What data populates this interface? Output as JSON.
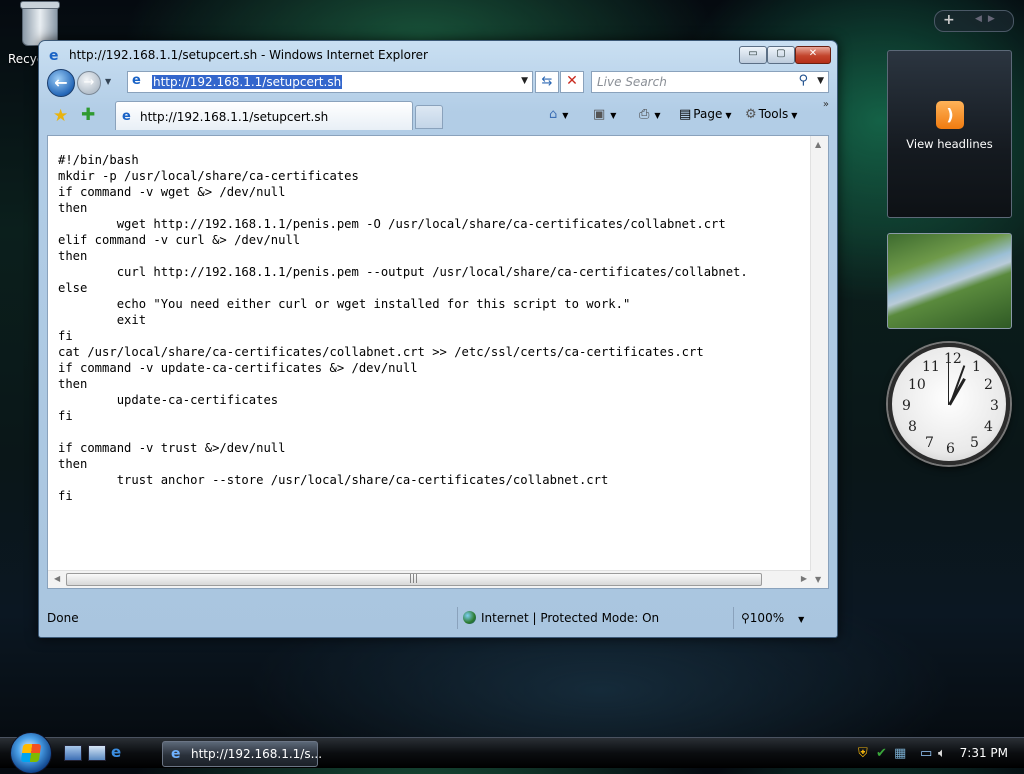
{
  "desktop": {
    "recycle_bin_label": "Recyc"
  },
  "window": {
    "title": "http://192.168.1.1/setupcert.sh - Windows Internet Explorer",
    "buttons": {
      "minimize": "▭",
      "maximize": "▢",
      "close": "✕"
    }
  },
  "nav": {
    "address": "http://192.168.1.1/setupcert.sh",
    "search_placeholder": "Live Search"
  },
  "tab": {
    "label": "http://192.168.1.1/setupcert.sh"
  },
  "command_bar": {
    "page_label": "Page",
    "tools_label": "Tools"
  },
  "content": {
    "code": "#!/bin/bash\nmkdir -p /usr/local/share/ca-certificates\nif command -v wget &> /dev/null\nthen\n        wget http://192.168.1.1/penis.pem -O /usr/local/share/ca-certificates/collabnet.crt\nelif command -v curl &> /dev/null\nthen\n        curl http://192.168.1.1/penis.pem --output /usr/local/share/ca-certificates/collabnet.\nelse\n        echo \"You need either curl or wget installed for this script to work.\"\n        exit\nfi\ncat /usr/local/share/ca-certificates/collabnet.crt >> /etc/ssl/certs/ca-certificates.crt\nif command -v update-ca-certificates &> /dev/null\nthen\n        update-ca-certificates\nfi\n\nif command -v trust &>/dev/null\nthen\n        trust anchor --store /usr/local/share/ca-certificates/collabnet.crt\nfi"
  },
  "status": {
    "text": "Done",
    "zone": "Internet | Protected Mode: On",
    "zoom": "100%"
  },
  "sidebar": {
    "feed_label": "View headlines",
    "clock_numbers": [
      "12",
      "1",
      "2",
      "3",
      "4",
      "5",
      "6",
      "7",
      "8",
      "9",
      "10",
      "11"
    ]
  },
  "taskbar": {
    "task_label": "http://192.168.1.1/s...",
    "time": "7:31 PM"
  },
  "icons": {
    "rss": "rss-icon",
    "home": "home-icon",
    "print": "print-icon",
    "tools": "gear-icon"
  }
}
